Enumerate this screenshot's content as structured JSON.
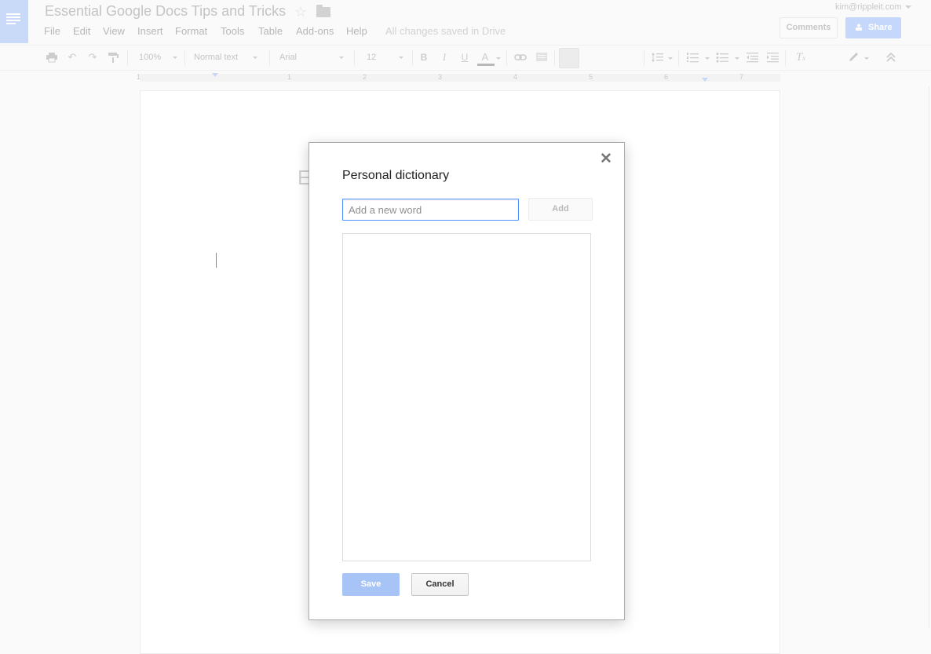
{
  "app": {
    "doc_title": "Essential Google Docs Tips and Tricks",
    "saved_status": "All changes saved in Drive",
    "account_email": "kim@rippleit.com",
    "comments_label": "Comments",
    "share_label": "Share"
  },
  "menu": [
    "File",
    "Edit",
    "View",
    "Insert",
    "Format",
    "Tools",
    "Table",
    "Add-ons",
    "Help"
  ],
  "toolbar": {
    "zoom": "100%",
    "style": "Normal text",
    "font": "Arial",
    "size": "12",
    "bold": "B",
    "italic": "I",
    "underline": "U",
    "text_color": "A"
  },
  "ruler": {
    "numbers": [
      "1",
      "1",
      "2",
      "3",
      "4",
      "5",
      "6",
      "7"
    ]
  },
  "document": {
    "heading_fragment": "E"
  },
  "dialog": {
    "title": "Personal dictionary",
    "input_placeholder": "Add a new word",
    "input_value": "",
    "add_label": "Add",
    "save_label": "Save",
    "cancel_label": "Cancel",
    "words": []
  },
  "colors": {
    "accent_blue": "#4d90fe",
    "save_disabled": "#a8c4f7",
    "share_disabled": "#c5d7fa",
    "docs_logo": "#c9d9f8"
  },
  "icons": {
    "logo": "docs-logo-icon",
    "star": "star-icon",
    "folder": "folder-icon",
    "print": "print-icon",
    "undo": "undo-icon",
    "redo": "redo-icon",
    "paint_format": "paint-format-icon",
    "link": "link-icon",
    "comment": "insert-comment-icon",
    "line_spacing": "line-spacing-icon",
    "numbered_list": "numbered-list-icon",
    "bulleted_list": "bulleted-list-icon",
    "clear_formatting": "clear-formatting-icon",
    "editing_mode": "pencil-icon",
    "collapse": "collapse-icon",
    "close": "close-icon"
  }
}
